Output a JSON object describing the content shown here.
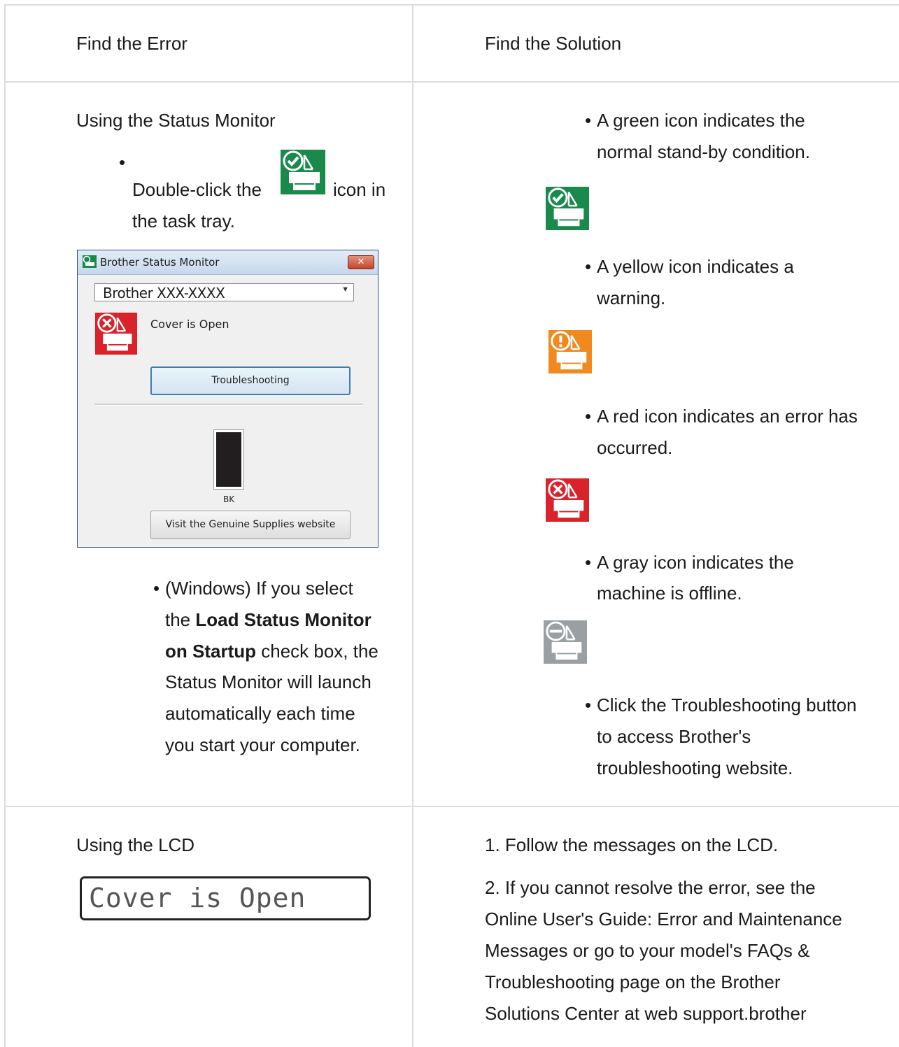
{
  "table": {
    "header": {
      "col1": "Find the Error",
      "col2": "Find the Solution"
    },
    "row1": {
      "error": {
        "title": "Using the Status Monitor",
        "double_click_pre": "Double-click the",
        "double_click_post": "icon in",
        "double_click_line2": "the task tray.",
        "windows_note": {
          "pre": "(Windows) If you select",
          "the": "the",
          "bold_a": "Load Status Monitor",
          "bold_b": "on Startup",
          "after_bold": "check box, the",
          "line4": "Status Monitor will launch",
          "line5": "automatically each time",
          "line6": "you start your computer."
        }
      },
      "solution": {
        "green": {
          "l1": "A green icon indicates the",
          "l2": "normal stand-by condition."
        },
        "yellow": {
          "l1": "A yellow icon indicates a",
          "l2": "warning."
        },
        "red": {
          "l1": "A red icon indicates an error has",
          "l2": "occurred."
        },
        "gray": {
          "l1": "A gray icon indicates the",
          "l2": "machine is offline."
        },
        "troubleshoot": {
          "l1": "Click the Troubleshooting button",
          "l2": "to access Brother's",
          "l3": "troubleshooting website."
        }
      }
    },
    "row2": {
      "error": {
        "title": "Using the LCD",
        "lcd_text": "Cover is Open"
      },
      "solution": {
        "step1": "1. Follow the messages on the LCD.",
        "step2": {
          "l1": "2. If you cannot resolve the error, see the",
          "l2": "Online User's Guide: Error and Maintenance",
          "l3": "Messages or go to your model's FAQs &",
          "l4": "Troubleshooting page on the Brother",
          "l5": "Solutions Center at web support.brother"
        }
      }
    }
  },
  "status_window": {
    "title": "Brother Status Monitor",
    "close_label": "✕",
    "device_name": "Brother  XXX-XXXX",
    "status_text": "Cover is Open",
    "troubleshoot_button": "Troubleshooting",
    "ink_label": "BK",
    "ink_level": 1.0,
    "supplies_button": "Visit the Genuine Supplies website"
  },
  "colors": {
    "green_icon": "#1a8a4c",
    "yellow_icon": "#f08a1e",
    "red_icon": "#d9222a",
    "gray_icon": "#9a9fa3",
    "grid_line": "#dcdcdc"
  }
}
